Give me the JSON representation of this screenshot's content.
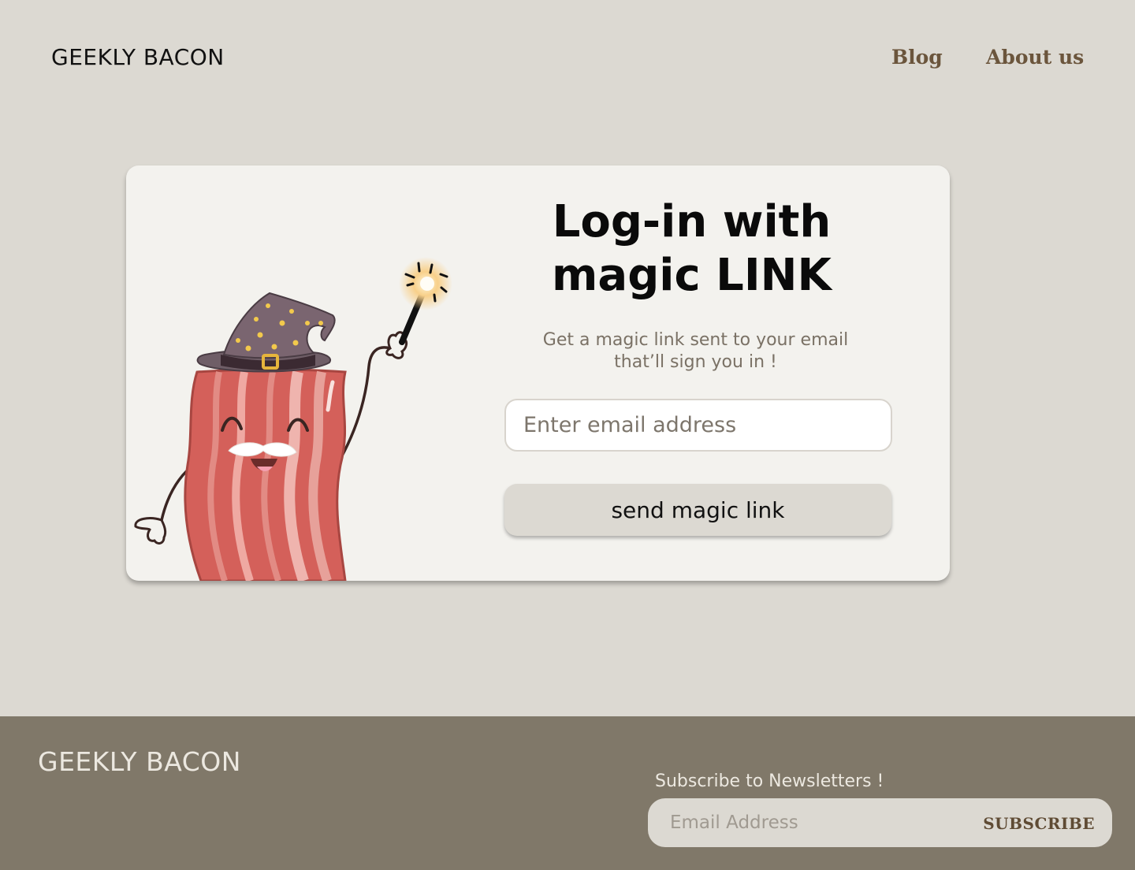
{
  "header": {
    "logo": "GEEKLY BACON",
    "nav": [
      {
        "label": "Blog"
      },
      {
        "label": "About us"
      }
    ]
  },
  "login": {
    "title_line1": "Log-in with",
    "title_line2": "magic LINK",
    "subtitle_line1": "Get a magic link sent to your email",
    "subtitle_line2": "that’ll sign you in !",
    "email_placeholder": "Enter email address",
    "send_label": "send magic link",
    "illustration": "bacon-wizard-icon"
  },
  "footer": {
    "logo": "GEEKLY BACON",
    "newsletter_label": "Subscribe to Newsletters !",
    "newsletter_placeholder": "Email Address",
    "subscribe_label": "SUBSCRIBE"
  },
  "colors": {
    "page_bg": "#dcd9d2",
    "card_bg": "#f3f2ee",
    "footer_bg": "#807869",
    "nav_link": "#6b553c",
    "bacon": "#d4605a"
  }
}
